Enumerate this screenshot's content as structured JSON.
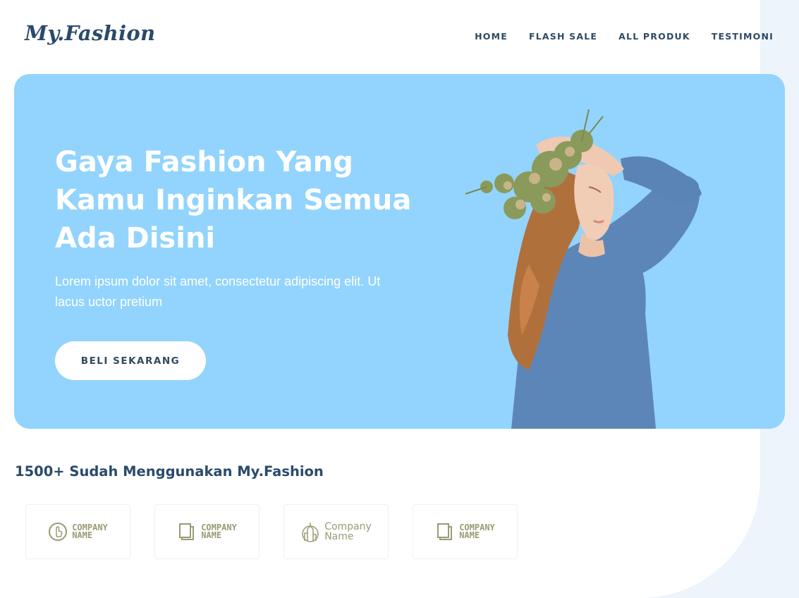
{
  "brand": {
    "logo": "My.Fashion"
  },
  "nav": {
    "items": [
      {
        "label": "HOME"
      },
      {
        "label": "FLASH SALE"
      },
      {
        "label": "ALL PRODUK"
      },
      {
        "label": "TESTIMONI"
      }
    ]
  },
  "hero": {
    "title": "Gaya Fashion Yang Kamu Inginkan Semua Ada Disini",
    "description": "Lorem ipsum dolor sit amet, consectetur adipiscing elit. Ut lacus uctor pretium",
    "cta_label": "BELI SEKARANG",
    "image_icon": "woman-in-blue-sweater-with-flowers-image"
  },
  "trust": {
    "title": "1500+ Sudah Menggunakan My.Fashion",
    "companies": [
      {
        "line1": "COMPANY",
        "line2": "NAME",
        "icon": "hand-pointer-icon"
      },
      {
        "line1": "COMPANY",
        "line2": "NAME",
        "icon": "pages-icon"
      },
      {
        "line1": "Company",
        "line2": "Name",
        "icon": "building-icon"
      },
      {
        "line1": "COMPANY",
        "line2": "NAME",
        "icon": "pages-icon"
      }
    ]
  },
  "colors": {
    "hero_bg": "#92d4fd",
    "brand_dark": "#2a4a6b",
    "logo_olive": "#9a9b73",
    "page_accent_bg": "#edf4fc"
  }
}
